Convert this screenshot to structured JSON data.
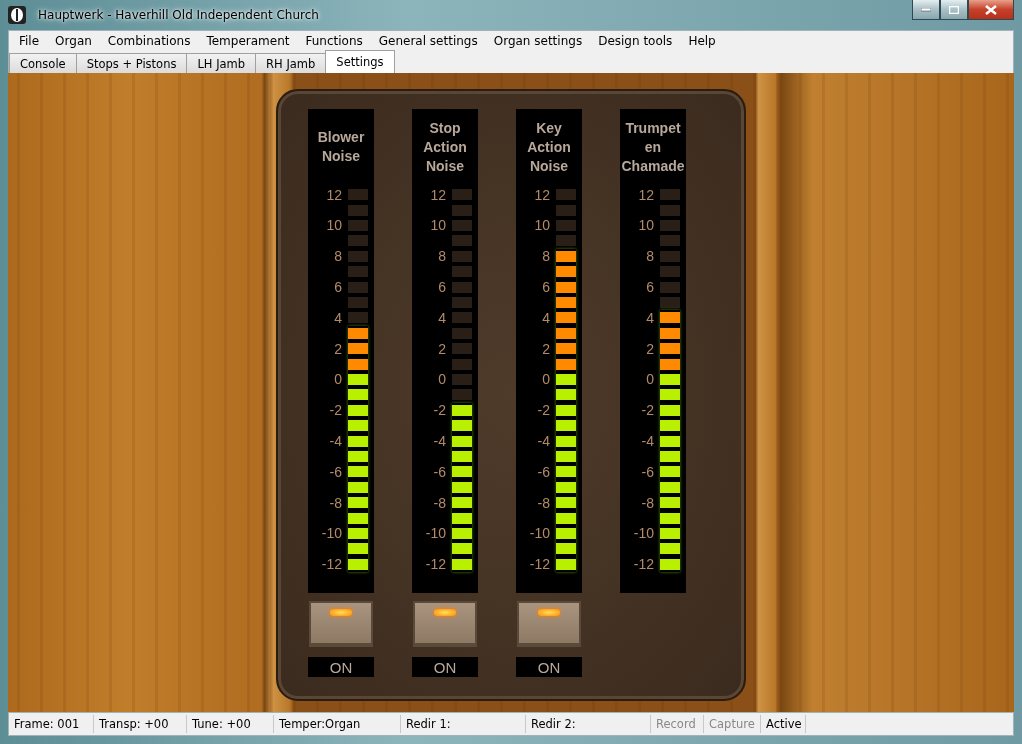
{
  "window": {
    "title": "Hauptwerk - Haverhill Old Independent Church"
  },
  "menu": [
    "File",
    "Organ",
    "Combinations",
    "Temperament",
    "Functions",
    "General settings",
    "Organ settings",
    "Design tools",
    "Help"
  ],
  "tabs": [
    {
      "label": "Console",
      "selected": false
    },
    {
      "label": "Stops + Pistons",
      "selected": false
    },
    {
      "label": "LH Jamb",
      "selected": false
    },
    {
      "label": "RH Jamb",
      "selected": false
    },
    {
      "label": "Settings",
      "selected": true
    }
  ],
  "meters": [
    {
      "title": "Blower Noise",
      "scale": [
        "12",
        "10",
        "8",
        "6",
        "4",
        "2",
        "0",
        "-2",
        "-4",
        "-6",
        "-8",
        "-10",
        "-12"
      ],
      "level": 0.64,
      "switch": {
        "label": "ON",
        "on": true
      }
    },
    {
      "title": "Stop Action Noise",
      "scale": [
        "12",
        "10",
        "8",
        "6",
        "4",
        "2",
        "0",
        "-2",
        "-4",
        "-6",
        "-8",
        "-10",
        "-12"
      ],
      "level": 0.44,
      "switch": {
        "label": "ON",
        "on": true
      }
    },
    {
      "title": "Key Action Noise",
      "scale": [
        "12",
        "10",
        "8",
        "6",
        "4",
        "2",
        "0",
        "-2",
        "-4",
        "-6",
        "-8",
        "-10",
        "-12"
      ],
      "level": 0.84,
      "switch": {
        "label": "ON",
        "on": true
      }
    },
    {
      "title": "Trumpet en Chamade",
      "scale": [
        "12",
        "10",
        "8",
        "6",
        "4",
        "2",
        "0",
        "-2",
        "-4",
        "-6",
        "-8",
        "-10",
        "-12"
      ],
      "level": 0.68
    }
  ],
  "status_bar": [
    {
      "text": "Frame: 001",
      "disabled": false
    },
    {
      "text": "Transp: +00",
      "disabled": false
    },
    {
      "text": "Tune: +00",
      "disabled": false
    },
    {
      "text": "Temper:Organ",
      "disabled": false
    },
    {
      "text": "Redir 1:",
      "disabled": false
    },
    {
      "text": "Redir 2:",
      "disabled": false
    },
    {
      "text": "Record",
      "disabled": true
    },
    {
      "text": "Capture",
      "disabled": true
    },
    {
      "text": "Active",
      "disabled": false
    }
  ]
}
